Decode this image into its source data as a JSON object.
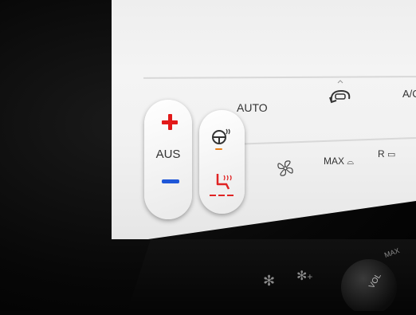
{
  "temperature": {
    "off_label": "AUS",
    "increase_icon": "plus-icon",
    "decrease_icon": "minus-icon"
  },
  "seat": {
    "steering_heat_icon": "heated-steering-wheel-icon",
    "seat_heat_icon": "heated-seat-icon"
  },
  "top_row": {
    "auto_label": "AUTO",
    "recirc_icon": "air-recirculation-icon",
    "ac_label": "A/C"
  },
  "bottom_row": {
    "fan_icon": "fan-icon",
    "max_defrost_label": "MAX",
    "rear_defrost_label": "R"
  },
  "console": {
    "fan_label": "+",
    "max_label": "MAX",
    "vol_label": "VOL"
  },
  "colors": {
    "plus": "#e21a1a",
    "minus": "#1f57d8",
    "seat_heat": "#e02424",
    "steering_heat": "#e8801a"
  }
}
